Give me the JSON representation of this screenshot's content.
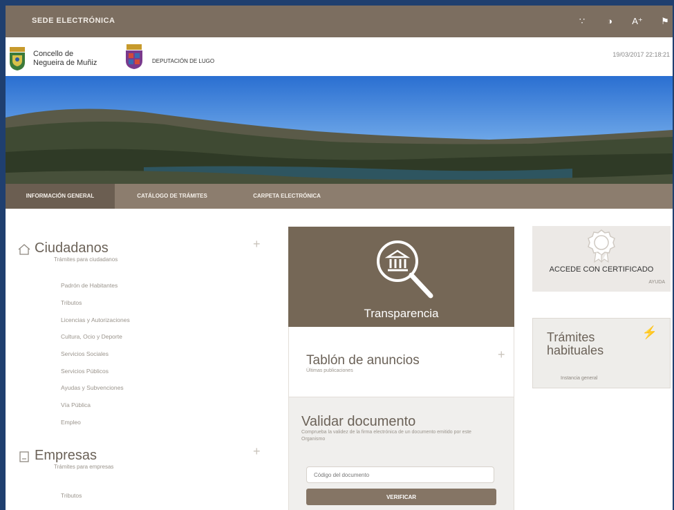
{
  "topbar": {
    "brand": "SEDE ELECTRÓNICA",
    "tools": [
      {
        "icon": "keyboard-dots-icon",
        "glyph": "∵"
      },
      {
        "icon": "contrast-icon",
        "glyph": "◑"
      },
      {
        "icon": "text-size-icon",
        "glyph": "A⁺"
      },
      {
        "icon": "flag-icon",
        "glyph": "⚑"
      }
    ]
  },
  "header": {
    "org_name": "Concello de Negueira de Muñiz",
    "dep_name": "DEPUTACIÓN DE LUGO",
    "datetime": "19/03/2017 22:18:21"
  },
  "nav": {
    "items": [
      {
        "label": "INFORMACIÓN GENERAL",
        "active": true
      },
      {
        "label": "CATÁLOGO DE TRÁMITES",
        "active": false
      },
      {
        "label": "CARPETA ELECTRÓNICA",
        "active": false
      }
    ]
  },
  "ciudadanos": {
    "title": "Ciudadanos",
    "subtitle": "Trámites para ciudadanos",
    "links": [
      "Padrón de Habitantes",
      "Tributos",
      "Licencias y Autorizaciones",
      "Cultura, Ocio y Deporte",
      "Servicios Sociales",
      "Servicios Públicos",
      "Ayudas y Subvenciones",
      "Vía Pública",
      "Empleo"
    ]
  },
  "empresas": {
    "title": "Empresas",
    "subtitle": "Trámites para empresas",
    "links": [
      "Tributos"
    ]
  },
  "transparencia": {
    "label": "Transparencia"
  },
  "tablon": {
    "title": "Tablón de anuncios",
    "subtitle": "Últimas publicaciones"
  },
  "validar": {
    "title": "Validar documento",
    "subtitle": "Comprueba la validez de la firma electrónica de un documento emitido por este Organismo",
    "input_placeholder": "Código del documento",
    "button": "VERIFICAR"
  },
  "cert": {
    "label": "ACCEDE CON CERTIFICADO",
    "help": "AYUDA"
  },
  "habituales": {
    "title": "Trámites habituales",
    "link": "Instancia general"
  },
  "colors": {
    "topbar": "#7c6e60",
    "nav": "#8c7d6e",
    "accent": "#756756"
  }
}
